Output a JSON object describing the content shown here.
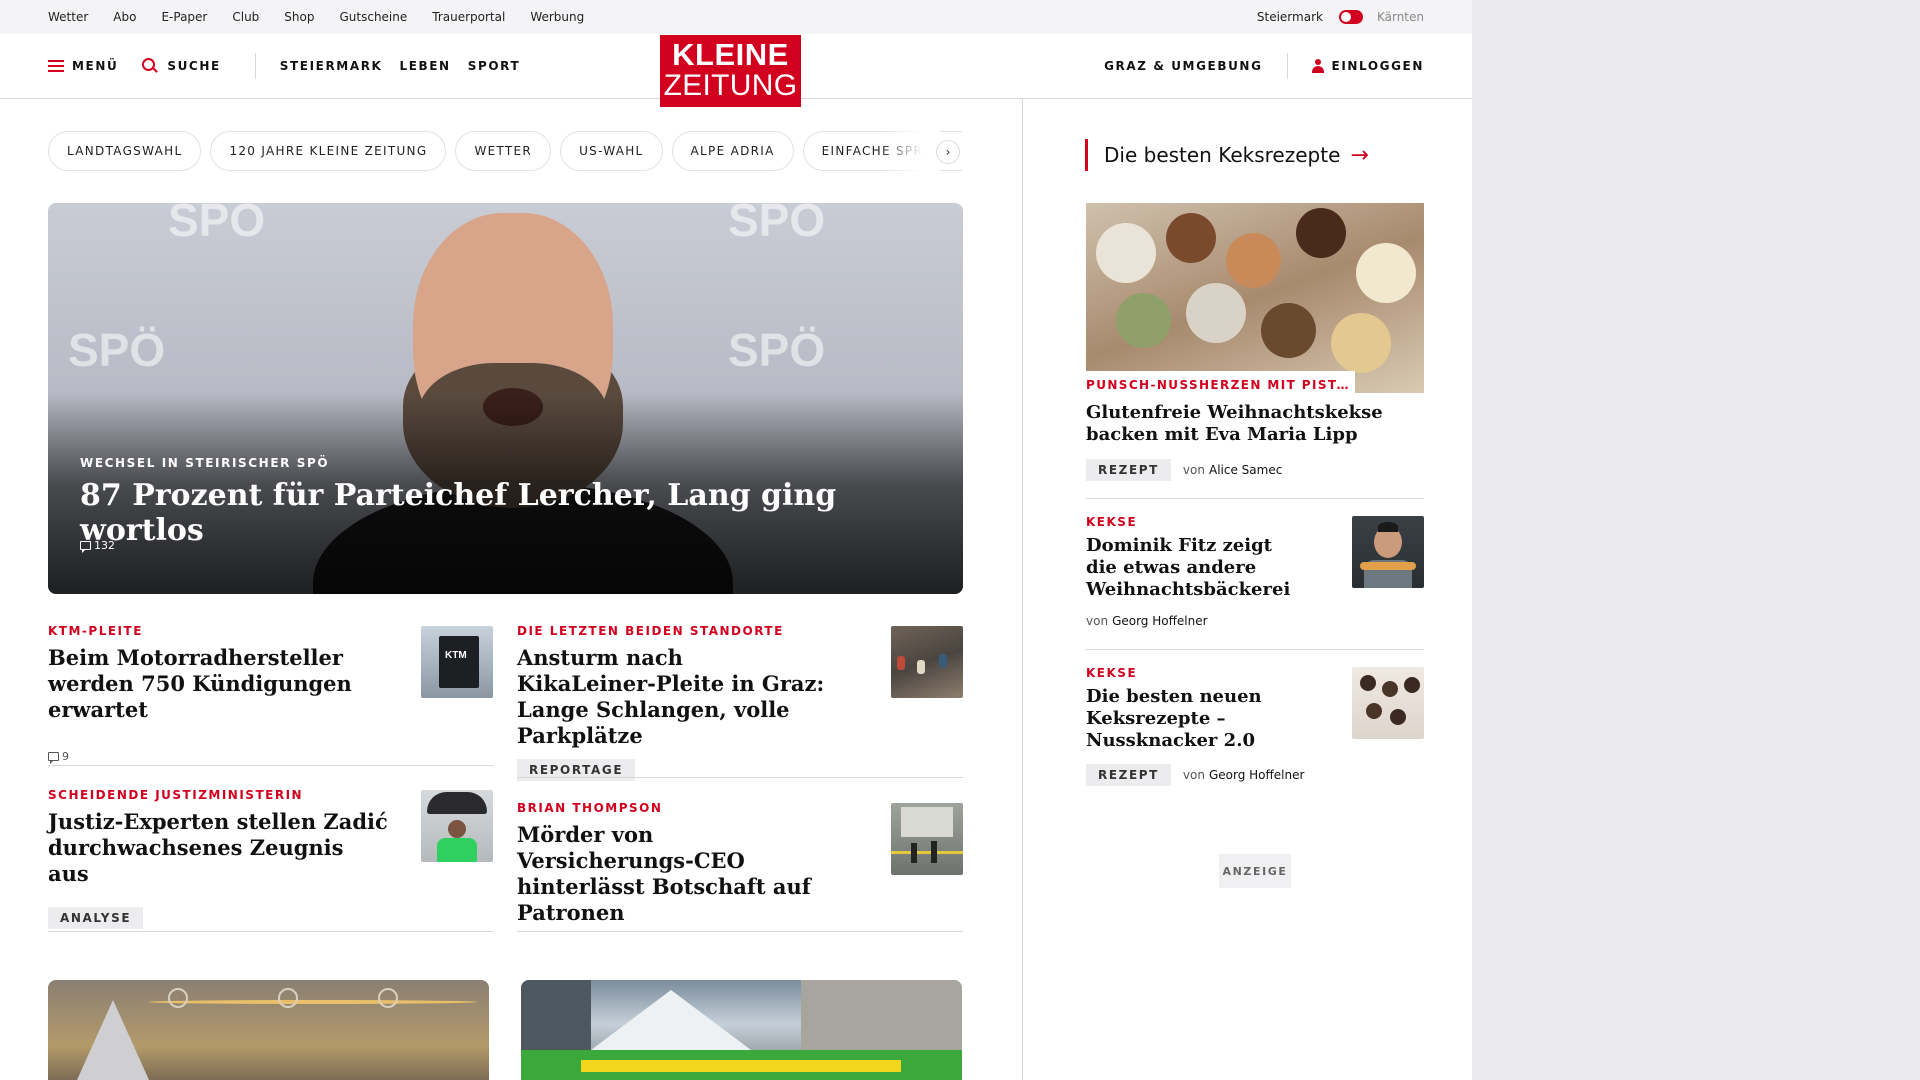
{
  "topbar": {
    "links": [
      "Wetter",
      "Abo",
      "E-Paper",
      "Club",
      "Shop",
      "Gutscheine",
      "Trauerportal",
      "Werbung"
    ],
    "region_active": "Steiermark",
    "region_inactive": "Kärnten"
  },
  "header": {
    "menu_label": "MENÜ",
    "search_label": "SUCHE",
    "nav": [
      "STEIERMARK",
      "LEBEN",
      "SPORT"
    ],
    "logo_line1": "KLEINE",
    "logo_line2": "ZEITUNG",
    "local_label": "GRAZ & UMGEBUNG",
    "login_label": "EINLOGGEN"
  },
  "tags": [
    "LANDTAGSWAHL",
    "120 JAHRE KLEINE ZEITUNG",
    "WETTER",
    "US-WAHL",
    "ALPE ADRIA",
    "EINFACHE SPRACHE"
  ],
  "hero": {
    "kicker": "WECHSEL IN STEIRISCHER SPÖ",
    "title": "87 Prozent für Parteichef Lercher, Lang ging wortlos",
    "comments": "132",
    "backdrop_text": "SPÖ"
  },
  "stories": [
    {
      "kicker": "KTM-PLEITE",
      "title": "Beim Motorradhersteller werden 750 Kündigungen erwartet",
      "comments": "9",
      "thumb_text": "KTM"
    },
    {
      "kicker": "DIE LETZTEN BEIDEN STANDORTE",
      "title": "Ansturm nach KikaLeiner-Pleite in Graz: Lange Schlangen, volle Parkplätze",
      "badge": "REPORTAGE"
    },
    {
      "kicker": "SCHEIDENDE JUSTIZMINISTERIN",
      "title": "Justiz-Experten stellen Zadić durchwachsenes Zeugnis aus",
      "badge": "ANALYSE"
    },
    {
      "kicker": "BRIAN THOMPSON",
      "title": "Mörder von Versicherungs-CEO hinterlässt Botschaft auf Patronen"
    }
  ],
  "sidebar": {
    "heading": "Die besten Keksrezepte",
    "feature": {
      "label": "PUNSCH-NUSSHERZEN MIT PISTAZIEN",
      "title": "Glutenfreie Weihnachtskekse backen mit Eva Maria Lipp",
      "badge": "REZEPT",
      "by": "von",
      "author": "Alice Samec"
    },
    "items": [
      {
        "kicker": "KEKSE",
        "title": "Dominik Fitz zeigt die etwas andere Weihnachtsbäckerei",
        "by": "von",
        "author": "Georg Hoffelner"
      },
      {
        "kicker": "KEKSE",
        "title": "Die besten neuen Keksrezepte – Nussknacker 2.0",
        "badge": "REZEPT",
        "by": "von",
        "author": "Georg Hoffelner"
      }
    ],
    "ad_label": "ANZEIGE"
  },
  "colors": {
    "brand": "#d2001e",
    "divider": "#d7d7dc",
    "badge_bg": "#ececef"
  }
}
